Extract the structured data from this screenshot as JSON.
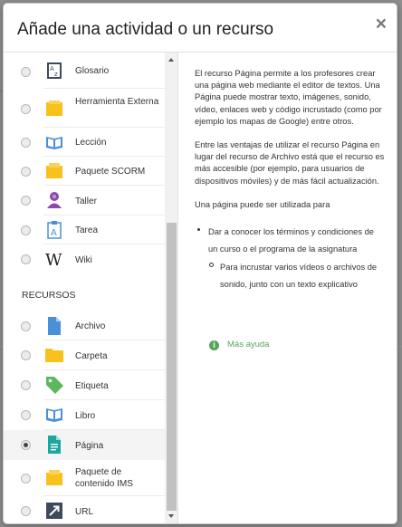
{
  "dialog": {
    "title": "Añade una actividad o un recurso",
    "close_symbol": "×"
  },
  "activities": [
    {
      "label": "Glosario",
      "icon": "glossary-icon",
      "selected": false
    },
    {
      "label": "Herramienta Externa",
      "icon": "external-tool-icon",
      "selected": false
    },
    {
      "label": "Lección",
      "icon": "lesson-icon",
      "selected": false
    },
    {
      "label": "Paquete SCORM",
      "icon": "scorm-package-icon",
      "selected": false
    },
    {
      "label": "Taller",
      "icon": "workshop-icon",
      "selected": false
    },
    {
      "label": "Tarea",
      "icon": "assignment-icon",
      "selected": false
    },
    {
      "label": "Wiki",
      "icon": "wiki-icon",
      "selected": false
    }
  ],
  "resources_section_title": "RECURSOS",
  "resources": [
    {
      "label": "Archivo",
      "icon": "file-icon",
      "selected": false
    },
    {
      "label": "Carpeta",
      "icon": "folder-icon",
      "selected": false
    },
    {
      "label": "Etiqueta",
      "icon": "label-tag-icon",
      "selected": false
    },
    {
      "label": "Libro",
      "icon": "book-icon",
      "selected": false
    },
    {
      "label": "Página",
      "icon": "page-icon",
      "selected": true
    },
    {
      "label": "Paquete de contenido IMS",
      "icon": "ims-package-icon",
      "selected": false
    },
    {
      "label": "URL",
      "icon": "url-icon",
      "selected": false
    }
  ],
  "help": {
    "paragraph1": "El recurso Página permite a los profesores crear una página web mediante el editor de textos. Una Página puede mostrar texto, imágenes, sonido, vídeo, enlaces web y código incrustado (como por ejemplo los mapas de Google) entre otros.",
    "paragraph2": "Entre las ventajas de utilizar el recurso Página en lugar del recurso de Archivo está que el recurso es más accesible (por ejemplo, para usuarios de dispositivos móviles) y de más fácil actualización.",
    "paragraph3": "Una página puede ser utilizada para",
    "bullet1": "Dar a conocer los términos y condiciones de un curso o el programa de la asignatura",
    "subbullet1": "Para incrustar varios vídeos o archivos de sonido, junto con un texto explicativo",
    "more_help": "Más ayuda",
    "info_glyph": "i"
  },
  "colors": {
    "accent_green": "#57a55a",
    "icon_yellow": "#f7c21b",
    "icon_blue": "#4a90d9",
    "icon_purple": "#8e4aa8",
    "icon_navy": "#3c4a5c",
    "icon_teal": "#1ba7a0"
  }
}
